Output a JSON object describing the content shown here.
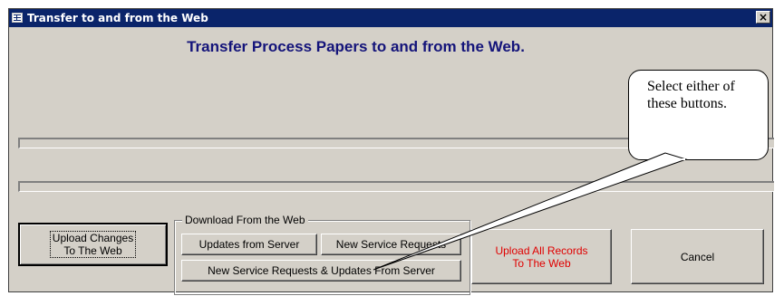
{
  "window": {
    "title": "Transfer to and from  the Web",
    "close_symbol": "×"
  },
  "heading": "Transfer Process Papers to and from the Web.",
  "progress_bars": [
    {
      "value": 0
    },
    {
      "value": 0
    }
  ],
  "buttons": {
    "upload_changes": "Upload Changes\nTo The Web",
    "upload_all": "Upload  All Records\nTo The Web",
    "cancel": "Cancel"
  },
  "download_group": {
    "legend": "Download From the Web",
    "updates_from_server": "Updates from Server",
    "new_service_requests": "New Service Requests",
    "new_and_updates": "New Service Requests & Updates From Server"
  },
  "callout": {
    "text": "Select either of these buttons."
  },
  "colors": {
    "titlebar": "#0a246a",
    "heading": "#14147a",
    "upload_all_text": "#e00000"
  },
  "icons": {
    "window": "form-icon",
    "close": "close-icon"
  }
}
